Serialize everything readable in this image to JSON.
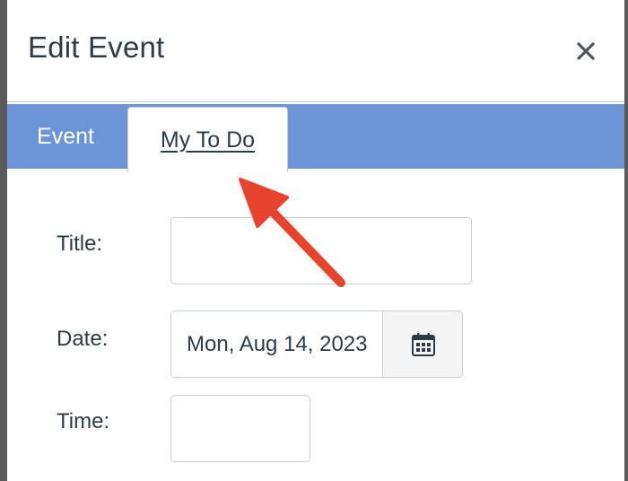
{
  "dialog": {
    "title": "Edit Event",
    "close_icon": "close-icon"
  },
  "tabs": [
    {
      "label": "Event",
      "selected": false
    },
    {
      "label": "My To Do",
      "selected": true
    }
  ],
  "form": {
    "title": {
      "label": "Title:",
      "value": ""
    },
    "date": {
      "label": "Date:",
      "value": "Mon, Aug 14, 2023",
      "button_icon": "calendar-icon"
    },
    "time": {
      "label": "Time:",
      "value": ""
    }
  },
  "annotation": {
    "icon": "red-arrow-icon",
    "color": "#e8432d"
  },
  "colors": {
    "tab_bar": "#6c95d8",
    "text": "#2d3b45",
    "border": "#c7cdd1"
  }
}
